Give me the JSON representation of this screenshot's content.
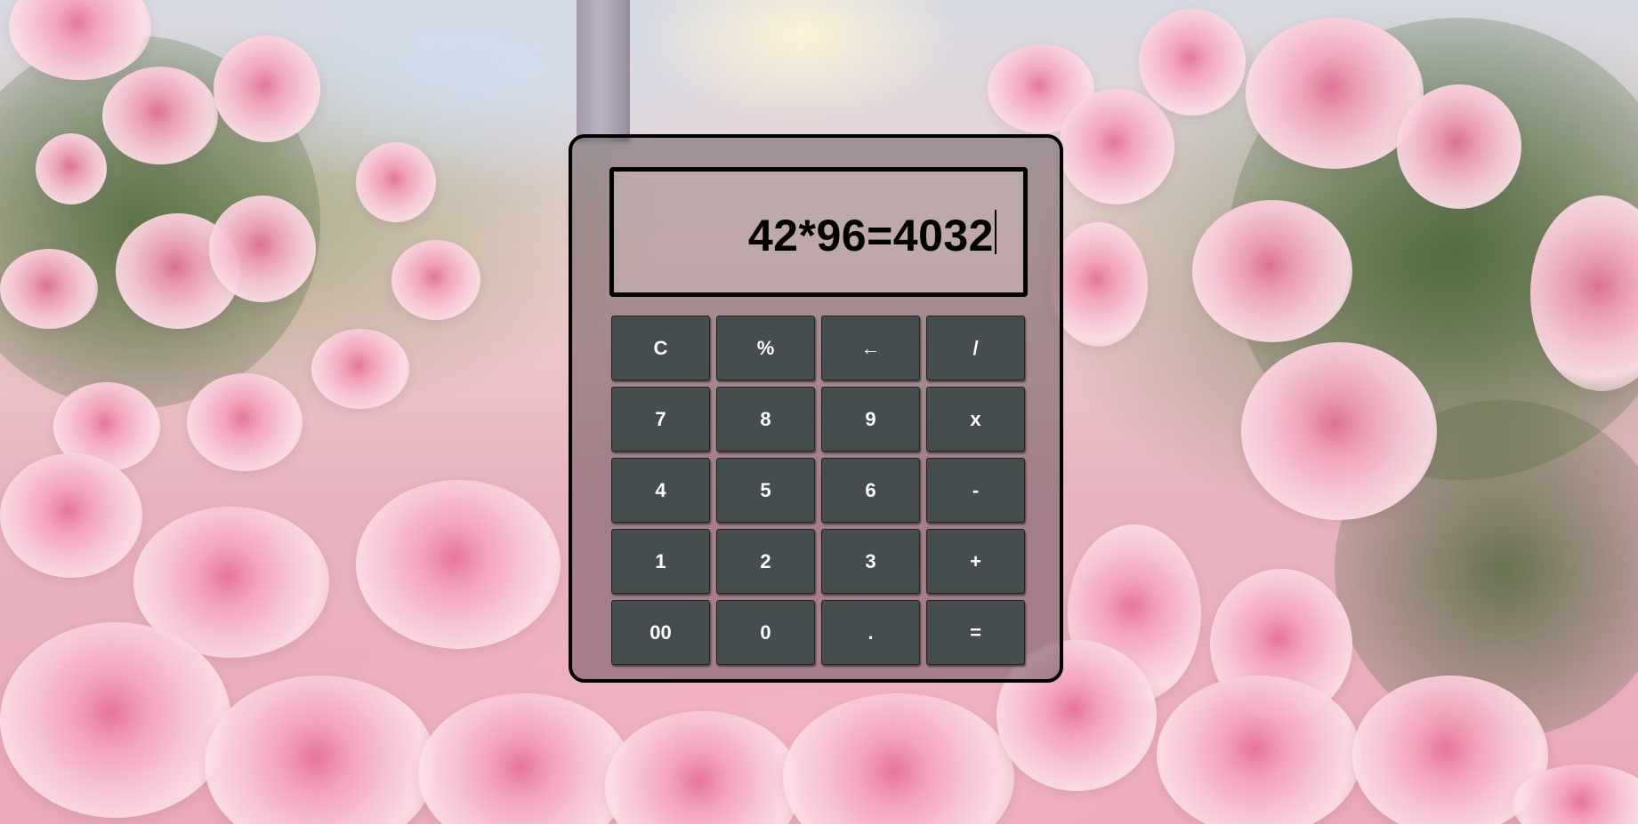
{
  "calculator": {
    "display_value": "42*96=4032",
    "keys": {
      "clear": "C",
      "percent": "%",
      "backspace": "←",
      "divide": "/",
      "seven": "7",
      "eight": "8",
      "nine": "9",
      "multiply": "x",
      "four": "4",
      "five": "5",
      "six": "6",
      "minus": "-",
      "one": "1",
      "two": "2",
      "three": "3",
      "plus": "+",
      "double_zero": "00",
      "zero": "0",
      "decimal": ".",
      "equals": "="
    }
  },
  "colors": {
    "key_background": "#454d4e",
    "key_text": "#ffffff",
    "display_border": "#000000",
    "frame_border": "#000000"
  }
}
